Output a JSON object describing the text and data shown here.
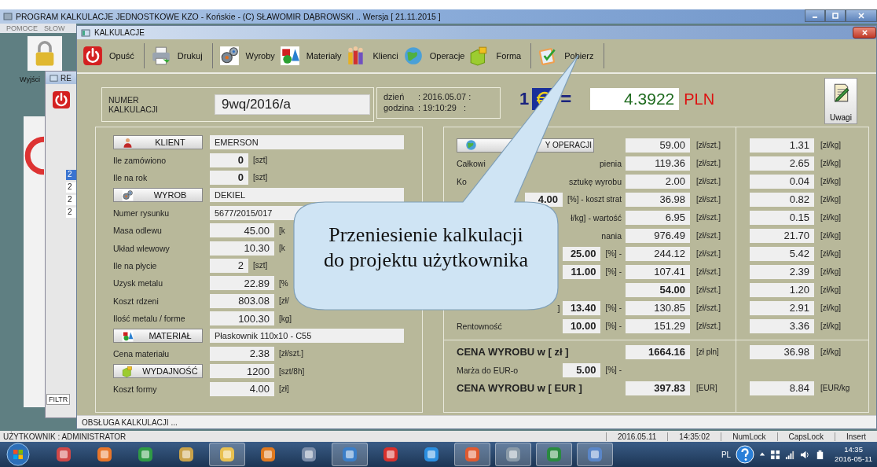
{
  "app_title": "PROGRAM KALKULACJE JEDNOSTKOWE KZO - Końskie  - (C) SŁAWOMIR DĄBROWSKI .. Wersja [ 21.11.2015 ]",
  "app_menu": [
    "POMOCE",
    "SŁOW"
  ],
  "desktop_shortcut": {
    "label": "Wyjści"
  },
  "back_window": {
    "title": "RE",
    "list": [
      {
        "text": "2",
        "selected": true
      },
      {
        "text": "2",
        "selected": false
      },
      {
        "text": "2",
        "selected": false
      },
      {
        "text": "2",
        "selected": false
      }
    ],
    "filter_label": "FILTR"
  },
  "window": {
    "title": "KALKULACJE"
  },
  "toolbar": [
    {
      "label": "Opuść",
      "divider": true
    },
    {
      "label": "Drukuj",
      "divider": true
    },
    {
      "label": "Wyroby",
      "divider": false
    },
    {
      "label": "Materiały",
      "divider": false
    },
    {
      "label": "Klienci",
      "divider": false
    },
    {
      "label": "Operacje",
      "divider": false
    },
    {
      "label": "Forma",
      "divider": true
    },
    {
      "label": "Pobierz",
      "divider": true
    }
  ],
  "numer": {
    "label": "NUMER KALKULACJI",
    "value": "9wq/2016/a"
  },
  "stamp": [
    {
      "label": "dzień",
      "value": ": 2016.05.07 :"
    },
    {
      "label": "godzina",
      "value": ": 19:10:29   :"
    }
  ],
  "rate": {
    "amount": "1",
    "equals": "=",
    "value": "4.3922",
    "currency": "PLN"
  },
  "notes_button": {
    "label": "Uwagi"
  },
  "left_rows": [
    {
      "kind": "button",
      "label": "KLIENT",
      "value": "EMERSON"
    },
    {
      "kind": "label",
      "label": "Ile zamówiono",
      "value": "0",
      "bold": true,
      "unit": "[szt]"
    },
    {
      "kind": "label",
      "label": "Ile na rok",
      "value": "0",
      "bold": true,
      "unit": "[szt]"
    },
    {
      "kind": "button",
      "label": "WYROB",
      "value": "DEKIEL"
    },
    {
      "kind": "label",
      "label": "Numer rysunku",
      "value": "5677/2015/017"
    },
    {
      "kind": "label",
      "label": "Masa odlewu",
      "value": "45.00",
      "unit": "[k"
    },
    {
      "kind": "label",
      "label": "Układ wlewowy",
      "value": "10.30",
      "unit": "[k"
    },
    {
      "kind": "label",
      "label": "Ile na płycie",
      "value": "2",
      "unit": "[szt]"
    },
    {
      "kind": "label",
      "label": "Uzysk metalu",
      "value": "22.89",
      "unit": "[%"
    },
    {
      "kind": "label",
      "label": "Koszt rdzeni",
      "value": "803.08",
      "unit": "[zł/"
    },
    {
      "kind": "label",
      "label": "Ilość metalu / forme",
      "value": "100.30",
      "unit": "[kg]"
    },
    {
      "kind": "button",
      "label": "MATERIAŁ",
      "value": "Płaskownik 110x10 - C55"
    },
    {
      "kind": "label",
      "label": "Cena materiału",
      "value": "2.38",
      "unit": "[zł/szt.]"
    },
    {
      "kind": "button",
      "label": "WYDAJNOŚĆ",
      "value": "1200",
      "unit": "[szt/8h]"
    },
    {
      "kind": "label",
      "label": "Koszt formy",
      "value": "4.00",
      "unit": "[zł]"
    }
  ],
  "right_rows": [
    {
      "kind": "button",
      "label": "Y OPERACJI",
      "value": "59.00",
      "unit": "[zł/szt.]",
      "kg_value": "1.31",
      "kg_unit": "[zł/kg]"
    },
    {
      "kind": "row",
      "label": "Całkowi",
      "label_tail": "pienia",
      "value": "119.36",
      "unit": "[zł/szt.]",
      "kg_value": "2.65",
      "kg_unit": "[zł/kg]"
    },
    {
      "kind": "row",
      "label": "Ko",
      "label_tail": "sztukę wyrobu",
      "value": "2.00",
      "unit": "[zł/szt.]",
      "kg_value": "0.04",
      "kg_unit": "[zł/kg]"
    },
    {
      "kind": "row",
      "pct": "4.00",
      "pct_unit": "[%] - koszt strat",
      "value": "36.98",
      "unit": "[zł/szt.]",
      "kg_value": "0.82",
      "kg_unit": "[zł/kg]"
    },
    {
      "kind": "row",
      "label_tail": "ł/kg] - wartość",
      "value": "6.95",
      "unit": "[zł/szt.]",
      "kg_value": "0.15",
      "kg_unit": "[zł/kg]"
    },
    {
      "kind": "row",
      "label_tail": "nania",
      "value": "976.49",
      "unit": "[zł/szt.]",
      "kg_value": "21.70",
      "kg_unit": "[zł/kg]"
    },
    {
      "kind": "row",
      "pct": "25.00",
      "pct_unit": "[%] -",
      "value": "244.12",
      "unit": "[zł/szt.]",
      "kg_value": "5.42",
      "kg_unit": "[zł/kg]"
    },
    {
      "kind": "row",
      "pct": "11.00",
      "pct_unit": "[%] -",
      "value": "107.41",
      "unit": "[zł/szt.]",
      "kg_value": "2.39",
      "kg_unit": "[zł/kg]"
    },
    {
      "kind": "row",
      "value": "54.00",
      "bold": true,
      "unit": "[zł/szt.]",
      "kg_value": "1.20",
      "kg_unit": "[zł/kg]"
    },
    {
      "kind": "row",
      "label_tail": "]",
      "pct": "13.40",
      "pct_unit": "[%] -",
      "value": "130.85",
      "unit": "[zł/szt.]",
      "kg_value": "2.91",
      "kg_unit": "[zł/kg]"
    },
    {
      "kind": "row",
      "label": "Rentowność",
      "pct": "10.00",
      "pct_unit": "[%] -",
      "value": "151.29",
      "unit": "[zł/szt.]",
      "kg_value": "3.36",
      "kg_unit": "[zł/kg]"
    }
  ],
  "totals": [
    {
      "kind": "total",
      "label": "CENA WYROBU w [ zł ]",
      "value": "1664.16",
      "bold": true,
      "unit": "[zł pln]",
      "kg_value": "36.98",
      "kg_unit": "[zł/kg]"
    },
    {
      "kind": "row",
      "label": "Marża do EUR-o",
      "pct": "5.00",
      "pct_unit": "[%] -"
    },
    {
      "kind": "total",
      "label": "CENA WYROBU w [ EUR ]",
      "value": "397.83",
      "bold": true,
      "unit": "[EUR]",
      "kg_value": "8.84",
      "kg_unit": "[EUR/kg"
    }
  ],
  "callout": {
    "lines": [
      "Przeniesienie kalkulacji",
      "do projektu użytkownika"
    ]
  },
  "window_status": "OBSŁUGA KALKULACJI ...",
  "app_status": {
    "user": "UŻYTKOWNIK : ADMINISTRATOR",
    "cells": [
      "2016.05.11",
      "14:35:02",
      "NumLock",
      "CapsLock",
      "Insert"
    ]
  },
  "taskbar": {
    "apps": [
      {
        "open": false
      },
      {
        "open": false
      },
      {
        "open": false
      },
      {
        "open": false
      },
      {
        "open": true
      },
      {
        "open": false
      },
      {
        "open": false
      },
      {
        "open": true
      },
      {
        "open": false
      },
      {
        "open": false
      },
      {
        "open": true
      },
      {
        "open": true
      },
      {
        "open": true
      },
      {
        "open": true
      }
    ],
    "language": "PL",
    "time": "14:35",
    "date": "2016-05-11"
  }
}
